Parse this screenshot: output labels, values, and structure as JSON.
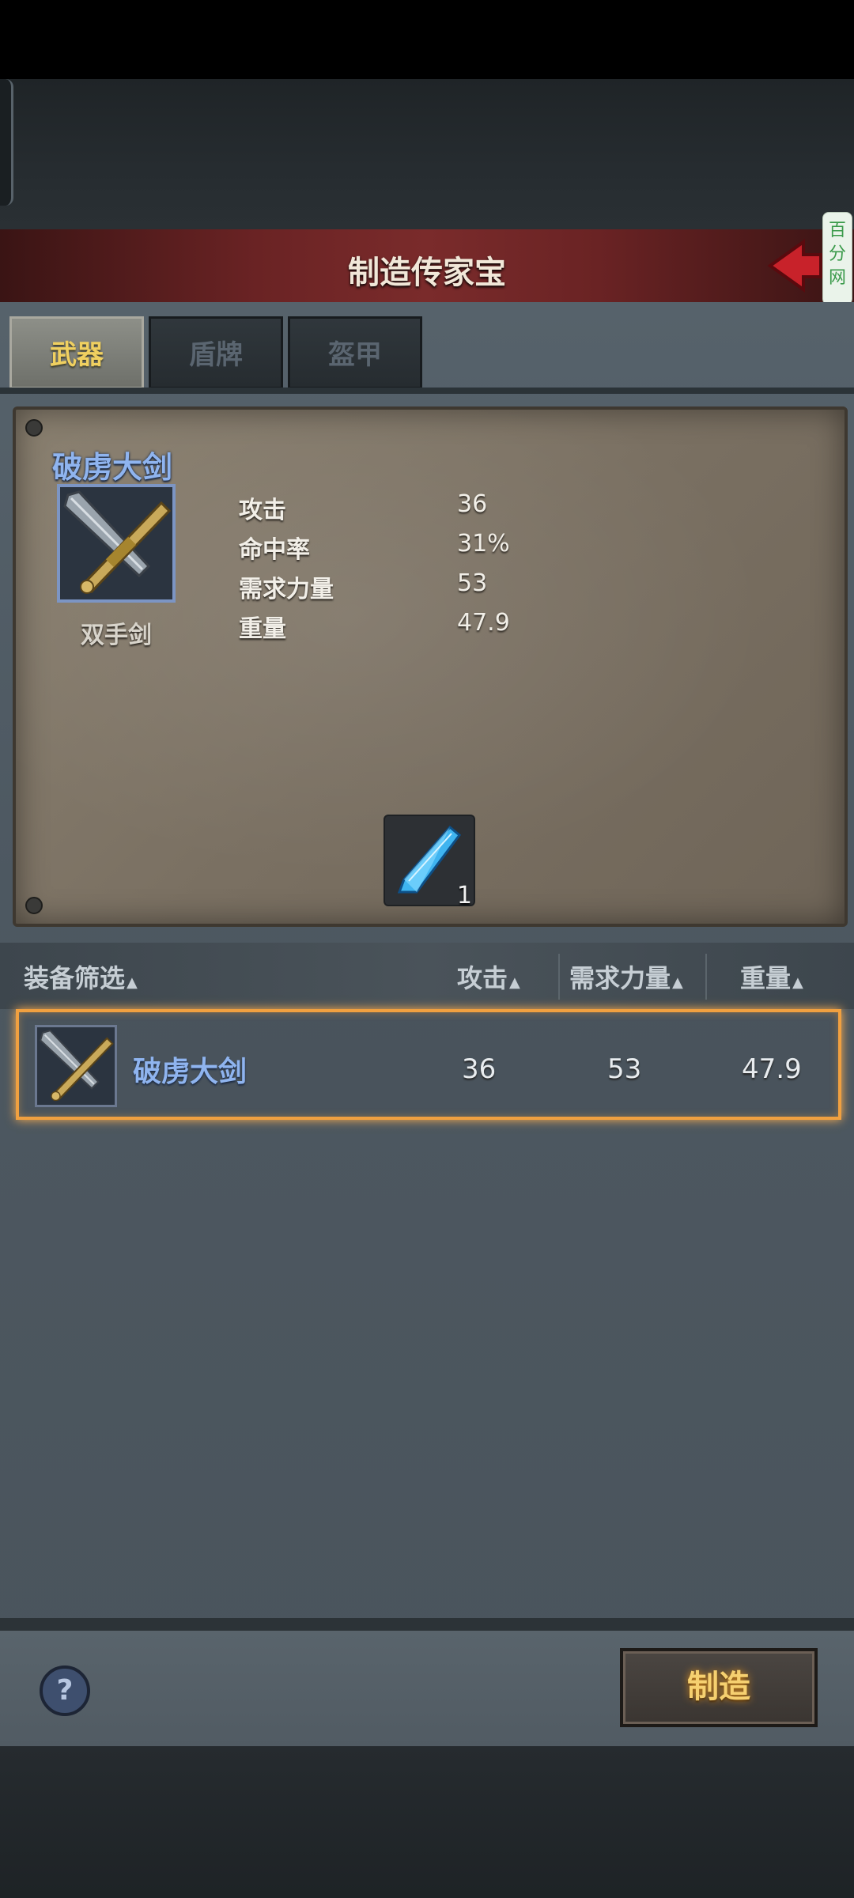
{
  "header": {
    "title": "制造传家宝",
    "side_badge": "百分网"
  },
  "tabs": [
    {
      "label": "武器",
      "active": true
    },
    {
      "label": "盾牌",
      "active": false
    },
    {
      "label": "盔甲",
      "active": false
    }
  ],
  "item_detail": {
    "name": "破虏大剑",
    "type": "双手剑",
    "stats": [
      {
        "label": "攻击",
        "value": "36"
      },
      {
        "label": "命中率",
        "value": "31%"
      },
      {
        "label": "需求力量",
        "value": "53"
      },
      {
        "label": "重量",
        "value": "47.9"
      }
    ],
    "material": {
      "icon": "blue-crystal-icon",
      "count": "1"
    }
  },
  "list": {
    "headers": {
      "filter": "装备筛选",
      "attack": "攻击",
      "strength": "需求力量",
      "weight": "重量"
    },
    "sort_indicator": "▲",
    "rows": [
      {
        "name": "破虏大剑",
        "attack": "36",
        "strength": "53",
        "weight": "47.9",
        "selected": true
      }
    ]
  },
  "footer": {
    "help_label": "?",
    "make_button": "制造"
  },
  "colors": {
    "title_bar": "#7a2b2b",
    "item_name": "#8fb4ef",
    "active_tab_text": "#f0d060",
    "selection_border": "#f0a040",
    "make_button_text": "#f6d070"
  }
}
